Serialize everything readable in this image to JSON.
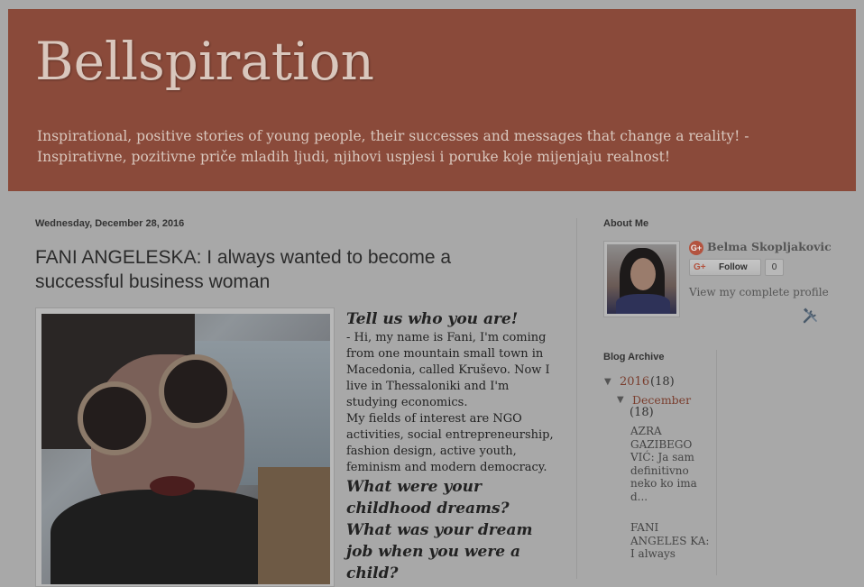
{
  "header": {
    "title": "Bellspiration",
    "description": "Inspirational, positive stories of young people, their successes and messages that change a reality! - Inspirativne, pozitivne priče mladih ljudi, njihovi uspjesi i poruke koje mijenjaju realnost!"
  },
  "post": {
    "date": "Wednesday, December 28, 2016",
    "title": "FANI ANGELESKA: I always wanted to become a successful business woman",
    "q1": "Tell us who you are!",
    "a1": "- Hi, my name is Fani, I'm coming from one mountain small town in Macedonia, called Kruševo. Now I live in Thessaloniki and I'm studying economics.",
    "a1b": "My fields of interest are NGO activities, social entrepreneurship, fashion design, active youth, feminism and modern democracy.",
    "q2": "What were your childhood dreams? What was your dream job when you were a child?"
  },
  "about": {
    "heading": "About Me",
    "name": "Belma Skopljakovic",
    "gplus_badge": "G+",
    "follow_label": "Follow",
    "follow_count": "0",
    "view_profile": "View my complete profile"
  },
  "archive": {
    "heading": "Blog Archive",
    "year": "2016",
    "year_count": "(18)",
    "month": "December",
    "month_count": "(18)",
    "posts": [
      "AZRA GAZIBEGO VIĆ: Ja sam definitivno neko ko ima d...",
      "FANI ANGELES KA: I always"
    ]
  },
  "colors": {
    "header_bg": "#8a4a3a",
    "link": "#7a3e2e",
    "page_bg": "#a8a8a8"
  }
}
